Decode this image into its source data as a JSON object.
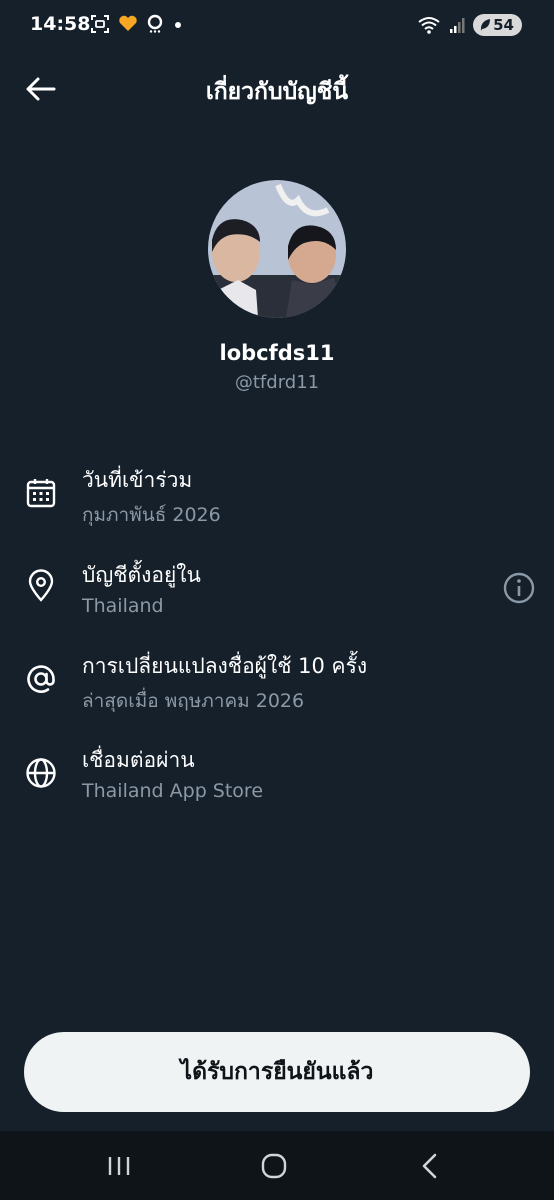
{
  "status_bar": {
    "time": "14:58",
    "battery": "54"
  },
  "header": {
    "title": "เกี่ยวกับบัญชีนี้"
  },
  "profile": {
    "display_name": "lobcfds11",
    "handle": "@tfdrd11"
  },
  "info_rows": [
    {
      "icon": "calendar-icon",
      "title": "วันที่เข้าร่วม",
      "subtitle": "กุมภาพันธ์ 2026"
    },
    {
      "icon": "location-pin-icon",
      "title": "บัญชีตั้งอยู่ใน",
      "subtitle": "Thailand"
    },
    {
      "icon": "at-sign-icon",
      "title": "การเปลี่ยนแปลงชื่อผู้ใช้ 10 ครั้ง",
      "subtitle": "ล่าสุดเมื่อ พฤษภาคม 2026"
    },
    {
      "icon": "globe-icon",
      "title": "เชื่อมต่อผ่าน",
      "subtitle": "Thailand App Store"
    }
  ],
  "verified_button": {
    "label": "ได้รับการยืนยันแล้ว"
  },
  "colors": {
    "background": "#15202b",
    "secondary_text": "#8b98a5",
    "button_bg": "#eff3f4",
    "nav_bar": "#0f1419"
  }
}
